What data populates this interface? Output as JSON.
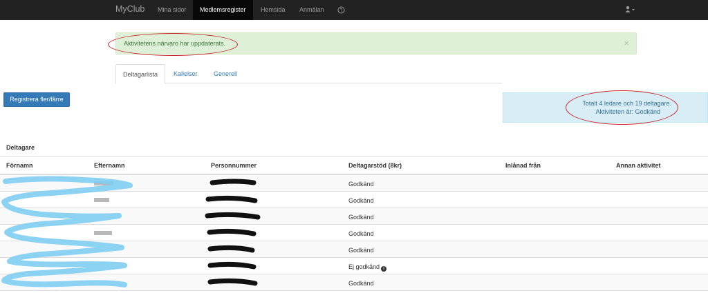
{
  "navbar": {
    "brand": "MyClub",
    "links": [
      {
        "label": "Mina sidor"
      },
      {
        "label": "Medlemsregister"
      },
      {
        "label": "Hemsida"
      },
      {
        "label": "Anmälan"
      },
      {
        "label": "?"
      }
    ],
    "active_link": "Medlemsregister"
  },
  "alert": {
    "text": "Aktivitetens närvaro har uppdaterats.",
    "close": "×"
  },
  "tabs": [
    {
      "label": "Deltagarlista"
    },
    {
      "label": "Kallelser"
    },
    {
      "label": "Generell"
    }
  ],
  "register_button": "Registrera fler/färre",
  "info": {
    "line1": "Totalt 4 ledare och 19 deltagare.",
    "line2_prefix": "Aktiviteten är: ",
    "line2_status": "Godkänd"
  },
  "table": {
    "title": "Deltagare",
    "headers": [
      "Förnamn",
      "Efternamn",
      "Personnummer",
      "Deltagarstöd (8kr)",
      "Inlånad från",
      "Annan aktivitet"
    ],
    "rows": [
      {
        "status": "Godkänd"
      },
      {
        "status": "Godkänd"
      },
      {
        "status": "Godkänd"
      },
      {
        "status": "Godkänd"
      },
      {
        "status": "Godkänd"
      },
      {
        "status": "Ej godkänd",
        "info": true
      },
      {
        "status": "Godkänd"
      }
    ]
  },
  "colors": {
    "navbar": "#222222",
    "primary": "#337ab7",
    "alert_bg": "#dff0d8",
    "info_bg": "#d9edf7",
    "annotation_red": "#c8262a",
    "redaction_blue": "#7fcdf2"
  },
  "icons": {
    "help": "question-circle-icon",
    "user": "user-icon",
    "caret": "caret-down-icon",
    "info": "info-circle-icon"
  }
}
